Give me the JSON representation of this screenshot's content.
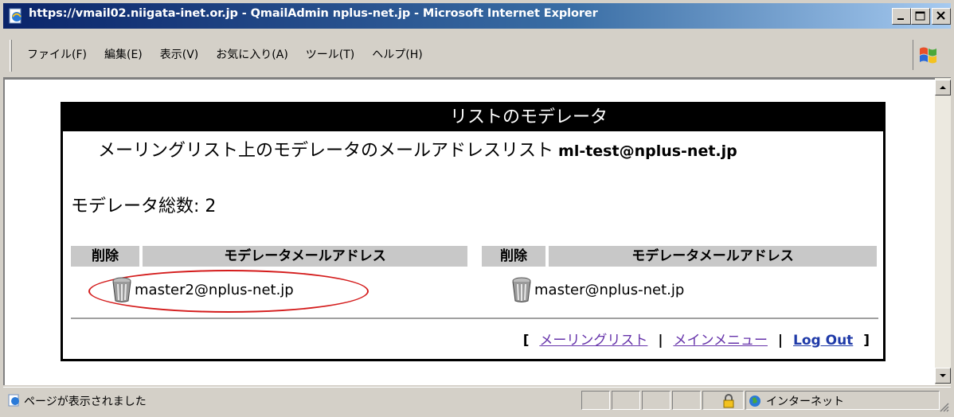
{
  "window": {
    "title": "https://vmail02.niigata-inet.or.jp - QmailAdmin nplus-net.jp - Microsoft Internet Explorer"
  },
  "menu": {
    "items": [
      "ファイル(F)",
      "編集(E)",
      "表示(V)",
      "お気に入り(A)",
      "ツール(T)",
      "ヘルプ(H)"
    ]
  },
  "panel": {
    "header": "リストのモデレータ",
    "subtitle": "メーリングリスト上のモデレータのメールアドレスリスト",
    "list_address": "ml-test@nplus-net.jp",
    "count_label": "モデレータ総数: ",
    "count_value": "2",
    "columns": {
      "delete": "削除",
      "address": "モデレータメールアドレス"
    },
    "moderators": [
      {
        "address": "master2@nplus-net.jp",
        "highlighted": true
      },
      {
        "address": "master@nplus-net.jp",
        "highlighted": false
      }
    ],
    "footer": {
      "open_bracket": "[",
      "close_bracket": "]",
      "separator": "|",
      "link_mailinglist": "メーリングリスト",
      "link_mainmenu": "メインメニュー",
      "link_logout": "Log Out"
    }
  },
  "status": {
    "text": "ページが表示されました",
    "zone": "インターネット"
  },
  "colors": {
    "highlight_ellipse": "#d41c1c",
    "link_visited": "#6633aa",
    "link_logout": "#1f3aa8",
    "titlebar_start": "#0a246a"
  }
}
